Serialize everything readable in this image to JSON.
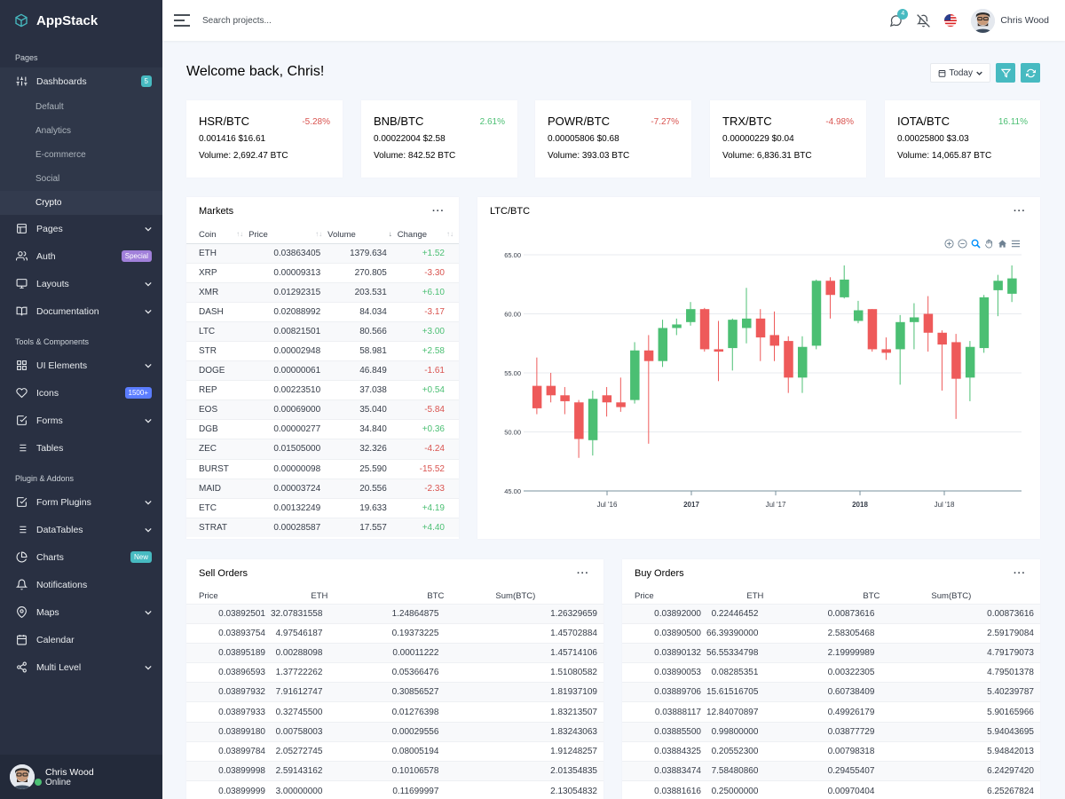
{
  "brand": "AppStack",
  "sidebar": {
    "section_pages": "Pages",
    "dashboards": {
      "label": "Dashboards",
      "badge": "5",
      "children": [
        "Default",
        "Analytics",
        "E-commerce",
        "Social",
        "Crypto"
      ]
    },
    "pages": "Pages",
    "auth": {
      "label": "Auth",
      "badge": "Special"
    },
    "layouts": "Layouts",
    "documentation": "Documentation",
    "section_tools": "Tools & Components",
    "ui_elements": "UI Elements",
    "icons": {
      "label": "Icons",
      "badge": "1500+"
    },
    "forms": "Forms",
    "tables": "Tables",
    "section_plugins": "Plugin & Addons",
    "form_plugins": "Form Plugins",
    "datatables": "DataTables",
    "charts": {
      "label": "Charts",
      "badge": "New"
    },
    "notifications": "Notifications",
    "maps": "Maps",
    "calendar": "Calendar",
    "multi_level": "Multi Level",
    "user": {
      "name": "Chris Wood",
      "status": "Online"
    }
  },
  "topbar": {
    "search_placeholder": "Search projects...",
    "notif_count": "4",
    "user_name": "Chris Wood"
  },
  "welcome": "Welcome back, Chris!",
  "filter_today": "Today",
  "tickers": [
    {
      "pair": "HSR/BTC",
      "change": "-5.28%",
      "price": "0.001416 $16.61",
      "volume": "Volume: 2,692.47 BTC"
    },
    {
      "pair": "BNB/BTC",
      "change": "2.61%",
      "price": "0.00022004 $2.58",
      "volume": "Volume: 842.52 BTC"
    },
    {
      "pair": "POWR/BTC",
      "change": "-7.27%",
      "price": "0.00005806 $0.68",
      "volume": "Volume: 393.03 BTC"
    },
    {
      "pair": "TRX/BTC",
      "change": "-4.98%",
      "price": "0.00000229 $0.04",
      "volume": "Volume: 6,836.31 BTC"
    },
    {
      "pair": "IOTA/BTC",
      "change": "16.11%",
      "price": "0.00025800 $3.03",
      "volume": "Volume: 14,065.87 BTC"
    }
  ],
  "markets": {
    "title": "Markets",
    "headers": [
      "Coin",
      "Price",
      "Volume",
      "Change"
    ],
    "rows": [
      [
        "ETH",
        "0.03863405",
        "1379.634",
        "+1.52"
      ],
      [
        "XRP",
        "0.00009313",
        "270.805",
        "-3.30"
      ],
      [
        "XMR",
        "0.01292315",
        "203.531",
        "+6.10"
      ],
      [
        "DASH",
        "0.02088992",
        "84.034",
        "-3.17"
      ],
      [
        "LTC",
        "0.00821501",
        "80.566",
        "+3.00"
      ],
      [
        "STR",
        "0.00002948",
        "58.981",
        "+2.58"
      ],
      [
        "DOGE",
        "0.00000061",
        "46.849",
        "-1.61"
      ],
      [
        "REP",
        "0.00223510",
        "37.038",
        "+0.54"
      ],
      [
        "EOS",
        "0.00069000",
        "35.040",
        "-5.84"
      ],
      [
        "DGB",
        "0.00000277",
        "34.840",
        "+0.36"
      ],
      [
        "ZEC",
        "0.01505000",
        "32.326",
        "-4.24"
      ],
      [
        "BURST",
        "0.00000098",
        "25.590",
        "-15.52"
      ],
      [
        "MAID",
        "0.00003724",
        "20.556",
        "-2.33"
      ],
      [
        "ETC",
        "0.00132249",
        "19.633",
        "+4.19"
      ],
      [
        "STRAT",
        "0.00028587",
        "17.557",
        "+4.40"
      ]
    ]
  },
  "chart_data": {
    "type": "candlestick",
    "title": "LTC/BTC",
    "ylim": [
      45,
      65
    ],
    "yticks": [
      "65.00",
      "60.00",
      "55.00",
      "50.00",
      "45.00"
    ],
    "xticks": [
      "Jul '16",
      "2017",
      "Jul '17",
      "2018",
      "Jul '18"
    ],
    "candles": [
      {
        "o": 53.9,
        "c": 52.0,
        "h": 56.3,
        "l": 51.5
      },
      {
        "o": 53.9,
        "c": 53.1,
        "h": 55.0,
        "l": 52.5
      },
      {
        "o": 53.1,
        "c": 52.6,
        "h": 53.8,
        "l": 51.5
      },
      {
        "o": 52.5,
        "c": 49.4,
        "h": 52.7,
        "l": 47.8
      },
      {
        "o": 49.3,
        "c": 52.8,
        "h": 53.5,
        "l": 48.0
      },
      {
        "o": 53.1,
        "c": 52.5,
        "h": 53.8,
        "l": 51.3
      },
      {
        "o": 52.5,
        "c": 52.1,
        "h": 54.6,
        "l": 51.7
      },
      {
        "o": 52.7,
        "c": 56.9,
        "h": 57.6,
        "l": 52.4
      },
      {
        "o": 56.9,
        "c": 56.0,
        "h": 58.2,
        "l": 49.0
      },
      {
        "o": 56.0,
        "c": 58.8,
        "h": 59.5,
        "l": 55.5
      },
      {
        "o": 58.8,
        "c": 59.1,
        "h": 59.6,
        "l": 58.2
      },
      {
        "o": 59.3,
        "c": 60.4,
        "h": 61.0,
        "l": 59.0
      },
      {
        "o": 60.4,
        "c": 57.0,
        "h": 60.5,
        "l": 56.8
      },
      {
        "o": 57.0,
        "c": 56.8,
        "h": 59.4,
        "l": 54.3
      },
      {
        "o": 57.1,
        "c": 59.5,
        "h": 59.6,
        "l": 55.2
      },
      {
        "o": 58.8,
        "c": 59.6,
        "h": 62.2,
        "l": 57.5
      },
      {
        "o": 59.6,
        "c": 58.0,
        "h": 60.4,
        "l": 56.0
      },
      {
        "o": 58.2,
        "c": 57.3,
        "h": 60.2,
        "l": 56.0
      },
      {
        "o": 57.7,
        "c": 54.6,
        "h": 58.1,
        "l": 53.3
      },
      {
        "o": 54.6,
        "c": 57.2,
        "h": 58.1,
        "l": 53.3
      },
      {
        "o": 57.3,
        "c": 62.8,
        "h": 62.9,
        "l": 57.0
      },
      {
        "o": 62.8,
        "c": 61.6,
        "h": 63.1,
        "l": 59.6
      },
      {
        "o": 61.4,
        "c": 62.9,
        "h": 64.1,
        "l": 61.3
      },
      {
        "o": 59.4,
        "c": 60.3,
        "h": 61.1,
        "l": 59.2
      },
      {
        "o": 60.4,
        "c": 57.0,
        "h": 60.4,
        "l": 56.8
      },
      {
        "o": 57.0,
        "c": 56.7,
        "h": 58.0,
        "l": 56.1
      },
      {
        "o": 57.0,
        "c": 59.3,
        "h": 59.9,
        "l": 54.0
      },
      {
        "o": 59.3,
        "c": 59.7,
        "h": 60.9,
        "l": 57.0
      },
      {
        "o": 60.0,
        "c": 58.4,
        "h": 61.5,
        "l": 56.8
      },
      {
        "o": 58.4,
        "c": 57.4,
        "h": 58.6,
        "l": 53.5
      },
      {
        "o": 57.6,
        "c": 54.5,
        "h": 58.3,
        "l": 51.1
      },
      {
        "o": 54.6,
        "c": 57.2,
        "h": 57.7,
        "l": 52.6
      },
      {
        "o": 57.1,
        "c": 61.4,
        "h": 61.6,
        "l": 56.7
      },
      {
        "o": 62.0,
        "c": 62.8,
        "h": 63.3,
        "l": 59.8
      },
      {
        "o": 61.7,
        "c": 63.0,
        "h": 64.1,
        "l": 61.0
      }
    ]
  },
  "sell_orders": {
    "title": "Sell Orders",
    "headers": [
      "Price",
      "ETH",
      "BTC",
      "Sum(BTC)"
    ],
    "rows": [
      [
        "0.03892501",
        "32.07831558",
        "1.24864875",
        "1.26329659"
      ],
      [
        "0.03893754",
        "4.97546187",
        "0.19373225",
        "1.45702884"
      ],
      [
        "0.03895189",
        "0.00288098",
        "0.00011222",
        "1.45714106"
      ],
      [
        "0.03896593",
        "1.37722262",
        "0.05366476",
        "1.51080582"
      ],
      [
        "0.03897932",
        "7.91612747",
        "0.30856527",
        "1.81937109"
      ],
      [
        "0.03897933",
        "0.32745500",
        "0.01276398",
        "1.83213507"
      ],
      [
        "0.03899180",
        "0.00758003",
        "0.00029556",
        "1.83243063"
      ],
      [
        "0.03899784",
        "2.05272745",
        "0.08005194",
        "1.91248257"
      ],
      [
        "0.03899998",
        "2.59143162",
        "0.10106578",
        "2.01354835"
      ],
      [
        "0.03899999",
        "3.00000000",
        "0.11699997",
        "2.13054832"
      ]
    ]
  },
  "buy_orders": {
    "title": "Buy Orders",
    "headers": [
      "Price",
      "ETH",
      "BTC",
      "Sum(BTC)"
    ],
    "rows": [
      [
        "0.03892000",
        "0.22446452",
        "0.00873616",
        "0.00873616"
      ],
      [
        "0.03890500",
        "66.39390000",
        "2.58305468",
        "2.59179084"
      ],
      [
        "0.03890132",
        "56.55334798",
        "2.19999989",
        "4.79179073"
      ],
      [
        "0.03890053",
        "0.08285351",
        "0.00322305",
        "4.79501378"
      ],
      [
        "0.03889706",
        "15.61516705",
        "0.60738409",
        "5.40239787"
      ],
      [
        "0.03888117",
        "12.84070897",
        "0.49926179",
        "5.90165966"
      ],
      [
        "0.03885500",
        "0.99800000",
        "0.03877729",
        "5.94043695"
      ],
      [
        "0.03884325",
        "0.20552300",
        "0.00798318",
        "5.94842013"
      ],
      [
        "0.03883474",
        "7.58480860",
        "0.29455407",
        "6.24297420"
      ],
      [
        "0.03881616",
        "0.25000000",
        "0.00970404",
        "6.25267824"
      ]
    ]
  },
  "colors": {
    "sidebar": "#293042",
    "accent": "#47bac1",
    "up": "#4bbf73",
    "down": "#ee5a5a",
    "badge_special": "#a180da",
    "badge_icons": "#5b7dff"
  }
}
